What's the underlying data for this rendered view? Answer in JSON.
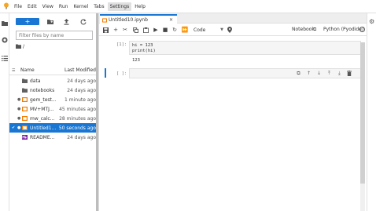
{
  "menubar": {
    "items": [
      "File",
      "Edit",
      "View",
      "Run",
      "Kernel",
      "Tabs",
      "Settings",
      "Help"
    ],
    "active": "Settings"
  },
  "filebrowser": {
    "new_label": "+",
    "filter_placeholder": "Filter files by name",
    "breadcrumb": "/",
    "columns": {
      "name": "Name",
      "modified": "Last Modified"
    },
    "rows": [
      {
        "name": "data",
        "modified": "24 days ago",
        "icon": "folder-icon"
      },
      {
        "name": "notebooks",
        "modified": "24 days ago",
        "icon": "folder-icon"
      },
      {
        "name": "gem_test...",
        "modified": "1 minute ago",
        "icon": "notebook-icon"
      },
      {
        "name": "MV+MTJ...",
        "modified": "45 minutes ago",
        "icon": "notebook-icon"
      },
      {
        "name": "mw_calc...",
        "modified": "28 minutes ago",
        "icon": "notebook-icon"
      },
      {
        "name": "Untitled1...",
        "modified": "50 seconds ago",
        "icon": "notebook-icon",
        "selected": true
      },
      {
        "name": "README...",
        "modified": "24 days ago",
        "icon": "markdown-icon"
      }
    ]
  },
  "notebook": {
    "tab_title": "Untitled10.ipynb",
    "cell_type": "Code",
    "label": "Notebook",
    "kernel": "Python (Pyodide)",
    "cells": [
      {
        "prompt": "[1]:",
        "source_line1": "hi = 123",
        "source_line2": "print(hi)",
        "output": "123"
      },
      {
        "prompt": "[ ]:"
      }
    ]
  },
  "colors": {
    "accent": "#1976d2",
    "logo": "#f5a623"
  }
}
